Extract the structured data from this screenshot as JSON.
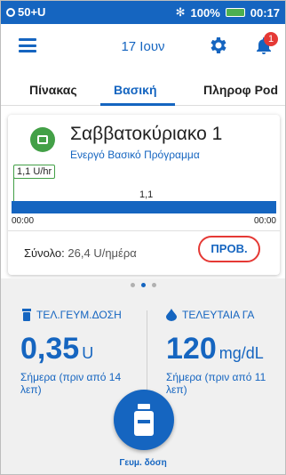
{
  "status_bar": {
    "left_text": "50+U",
    "right_battery": "100%",
    "time": "00:17"
  },
  "header": {
    "date": "17 Ιουν",
    "notification_count": "1"
  },
  "tabs": [
    {
      "label": "Πίνακας"
    },
    {
      "label": "Βασική"
    },
    {
      "label": "Πληροφ Pod"
    }
  ],
  "basal_card": {
    "program_name": "Σαββατοκύριακο 1",
    "program_status": "Ενεργό Βασικό Πρόγραμμα",
    "rate_flag": "1,1 U/hr",
    "segment_rate": "1,1",
    "start_time": "00:00",
    "end_time": "00:00",
    "total_label": "Σύνολο:",
    "total_value": "26,4 U/ημέρα",
    "preview_button": "ΠΡΟΒ."
  },
  "pager": {
    "current_page": 2,
    "total_pages": 3
  },
  "last_bolus": {
    "header": "ΤΕΛ.ΓΕΥΜ.ΔΟΣΗ",
    "value": "0,35",
    "unit": "U",
    "note": "Σήμερα (πριν από 14 λεπ)"
  },
  "last_bg": {
    "header": "ΤΕΛΕΥΤΑΙΑ ΓΑ",
    "value": "120",
    "unit": "mg/dL",
    "note": "Σήμερα (πριν από 11 λεπ)"
  },
  "fab": {
    "label": "Γευμ. δόση"
  },
  "colors": {
    "primary": "#1565c0",
    "alert": "#e53935",
    "program_icon": "#43a047"
  }
}
